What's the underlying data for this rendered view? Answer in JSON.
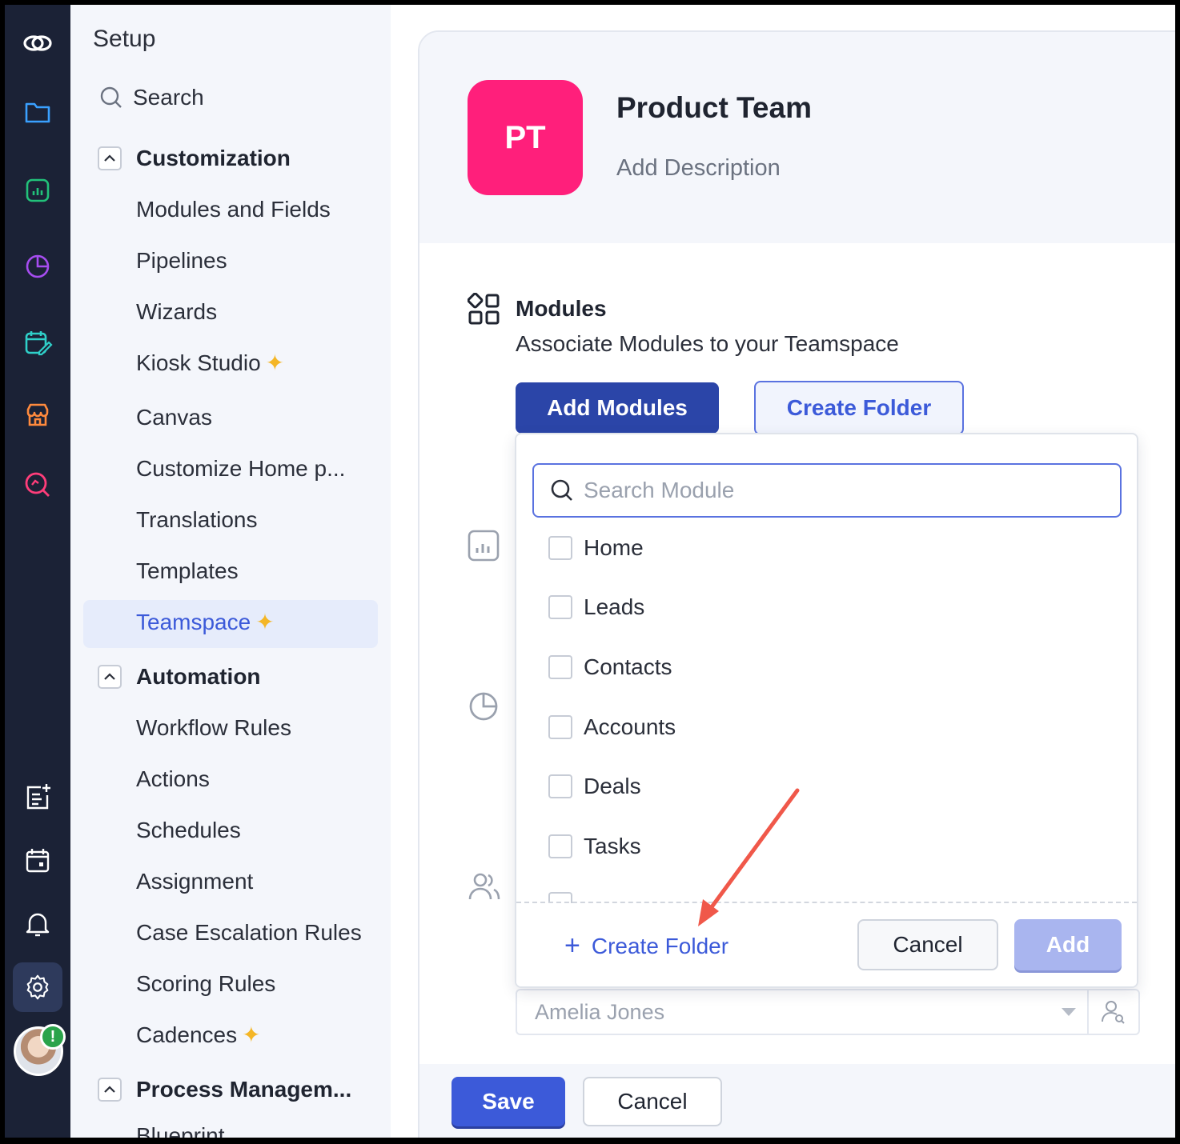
{
  "sidebar": {
    "title": "Setup",
    "search_label": "Search",
    "sections": [
      {
        "label": "Customization",
        "items": [
          "Modules and Fields",
          "Pipelines",
          "Wizards",
          "Kiosk Studio",
          "Canvas",
          "Customize Home p...",
          "Translations",
          "Templates",
          "Teamspace"
        ]
      },
      {
        "label": "Automation",
        "items": [
          "Workflow Rules",
          "Actions",
          "Schedules",
          "Assignment",
          "Case Escalation Rules",
          "Scoring Rules",
          "Cadences"
        ]
      },
      {
        "label": "Process Managem...",
        "items": [
          "Blueprint"
        ]
      }
    ],
    "active_item": "Teamspace"
  },
  "main": {
    "logo_initials": "PT",
    "team_name": "Product Team",
    "description_placeholder": "Add Description",
    "modules_title": "Modules",
    "modules_subtitle": "Associate Modules to your Teamspace",
    "add_modules_label": "Add Modules",
    "create_folder_label": "Create Folder",
    "owner_value": "Amelia Jones",
    "save_label": "Save",
    "cancel_label": "Cancel"
  },
  "dropdown": {
    "search_placeholder": "Search Module",
    "options": [
      "Home",
      "Leads",
      "Contacts",
      "Accounts",
      "Deals",
      "Tasks"
    ],
    "create_folder_label": "Create Folder",
    "cancel_label": "Cancel",
    "add_label": "Add"
  },
  "rail_icons": [
    "zoho-logo-icon",
    "folder-icon",
    "analytics-icon",
    "pie-chart-icon",
    "calendar-edit-icon",
    "store-icon",
    "search-analytics-icon",
    "add-note-icon",
    "calendar-icon",
    "bell-icon",
    "gear-icon",
    "avatar"
  ],
  "colors": {
    "rail_bg": "#1b2236",
    "accent": "#3c5ad9",
    "primary_dark": "#2b45a8",
    "logo_pink": "#ff1f7b",
    "sparkle": "#f4b626",
    "annotation_arrow": "#f0584a"
  }
}
